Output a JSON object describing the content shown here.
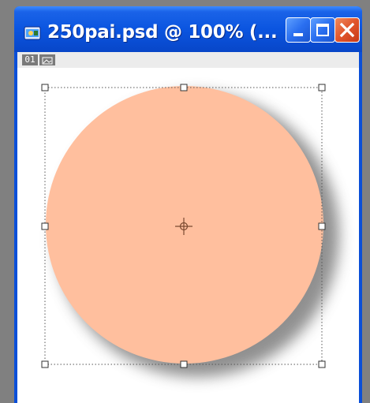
{
  "window": {
    "title": "250pai.psd @ 100% (...",
    "buttons": {
      "minimize": "minimize",
      "maximize": "maximize",
      "close": "close"
    }
  },
  "layer": {
    "number": "01"
  },
  "canvas": {
    "background": "#ffffff",
    "shape": "circle",
    "fill_color": "#ffbf9e",
    "shadow_color": "#7a7a7a",
    "selection_style": "dotted",
    "handles": "8 square handles with center crosshair"
  },
  "colors": {
    "titlebar": "#0b55e0",
    "close_button": "#e0552c",
    "window_border": "#0a4fd8"
  }
}
